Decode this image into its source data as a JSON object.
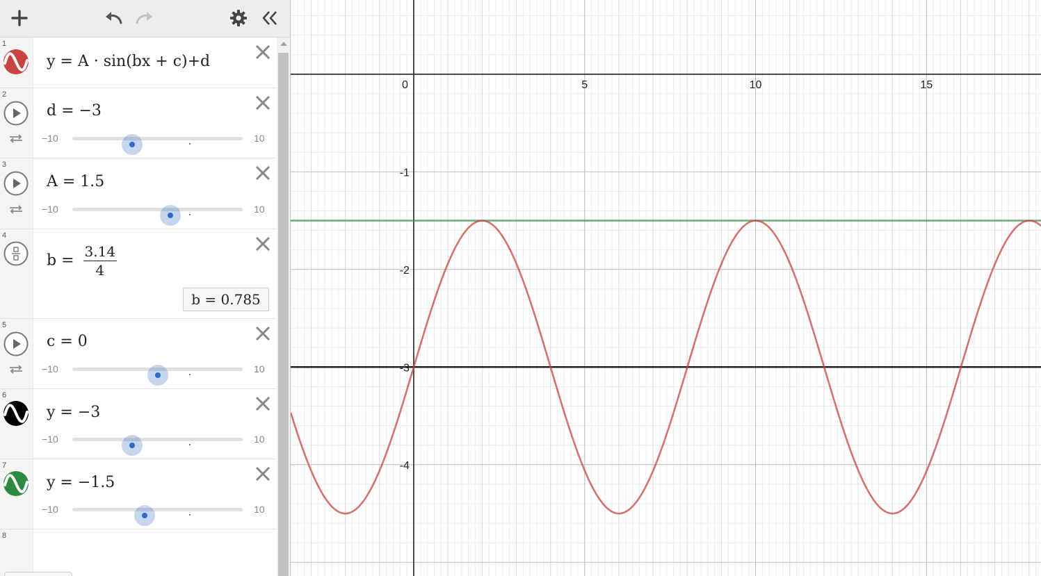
{
  "toolbar": {
    "add_icon": "plus-icon",
    "undo_icon": "undo-icon",
    "redo_icon": "redo-icon",
    "settings_icon": "gear-icon",
    "collapse_icon": "double-chevron-left-icon"
  },
  "expressions": [
    {
      "num": "1",
      "text": "y = A · sin(bx + c)+d",
      "color": "#c74440",
      "type": "function"
    },
    {
      "num": "2",
      "text": "d = −3",
      "slider": {
        "min": "−10",
        "max": "10",
        "value": -3
      }
    },
    {
      "num": "3",
      "text": "A = 1.5",
      "slider": {
        "min": "−10",
        "max": "10",
        "value": 1.5
      }
    },
    {
      "num": "4",
      "lhs": "b =",
      "numerator": "3.14",
      "denominator": "4",
      "eval": "b  =  0.785"
    },
    {
      "num": "5",
      "text": "c = 0",
      "slider": {
        "min": "−10",
        "max": "10",
        "value": 0
      }
    },
    {
      "num": "6",
      "text": "y = −3",
      "color": "#000000",
      "slider": {
        "min": "−10",
        "max": "10",
        "value": -3
      }
    },
    {
      "num": "7",
      "text": "y = −1.5",
      "color": "#2d8a3e",
      "slider": {
        "min": "−10",
        "max": "10",
        "value": -1.5
      }
    },
    {
      "num": "8"
    }
  ],
  "graph": {
    "x_ticks": [
      "0",
      "5",
      "10",
      "15"
    ],
    "y_ticks": [
      "-1",
      "-2",
      "-3",
      "-4"
    ],
    "params": {
      "A": 1.5,
      "b": 0.785,
      "c": 0,
      "d": -3
    },
    "x_range": [
      -3.6,
      18.35
    ],
    "y_range": [
      -5.14,
      0.76
    ],
    "curve_color": "#c74440",
    "hline_color": "#2d8a3e"
  }
}
